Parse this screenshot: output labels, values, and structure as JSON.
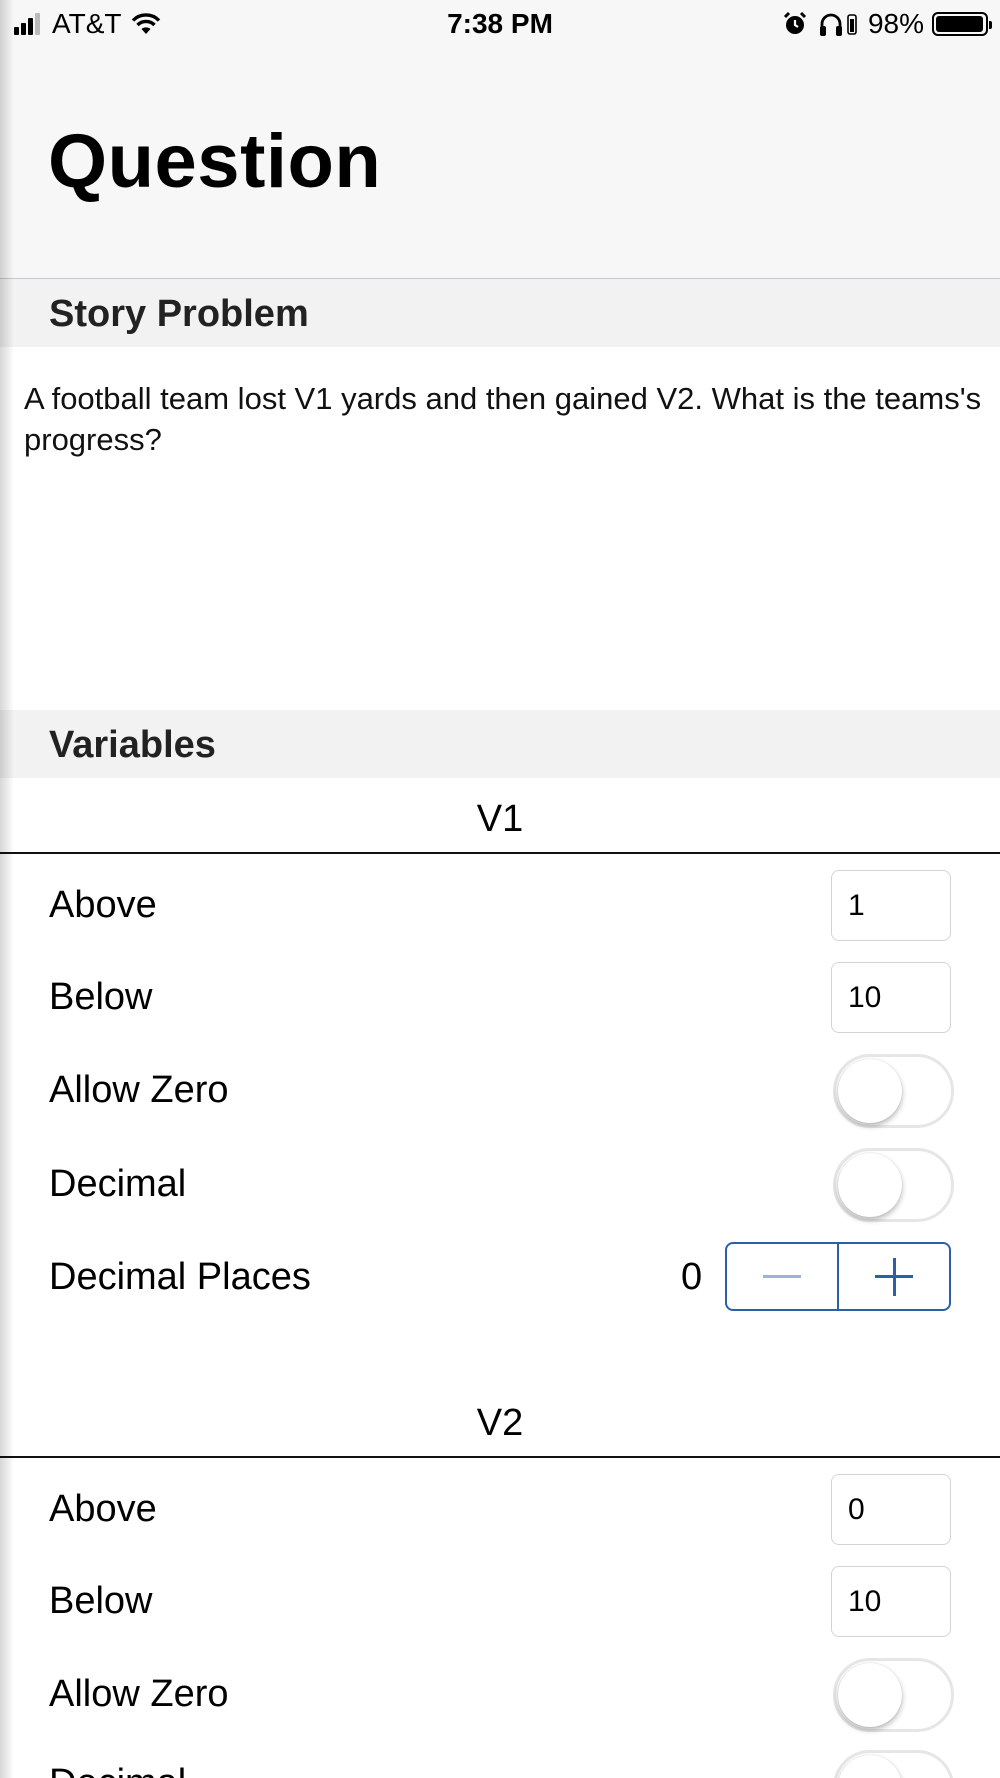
{
  "status_bar": {
    "carrier": "AT&T",
    "time": "7:38 PM",
    "battery": "98%",
    "battery_level": 0.98,
    "icons": [
      "signal-icon",
      "wifi-icon",
      "alarm-icon",
      "headphones-icon",
      "battery-icon"
    ]
  },
  "nav": {
    "title": "Question"
  },
  "story": {
    "header": "Story Problem",
    "text": "A football team lost V1 yards and then gained V2. What is the teams's progress?"
  },
  "variables": {
    "header": "Variables",
    "v1": {
      "name": "V1",
      "above_label": "Above",
      "above_value": "1",
      "below_label": "Below",
      "below_value": "10",
      "allow_zero_label": "Allow Zero",
      "allow_zero_on": false,
      "decimal_label": "Decimal",
      "decimal_on": false,
      "decimal_places_label": "Decimal Places",
      "decimal_places_value": "0"
    },
    "v2": {
      "name": "V2",
      "above_label": "Above",
      "above_value": "0",
      "below_label": "Below",
      "below_value": "10",
      "allow_zero_label": "Allow Zero",
      "allow_zero_on": false,
      "decimal_label": "Decimal",
      "decimal_on": false
    }
  },
  "colors": {
    "accent": "#2b5fa8",
    "header_bg": "#f2f2f2",
    "nav_bg": "#f7f7f7"
  }
}
